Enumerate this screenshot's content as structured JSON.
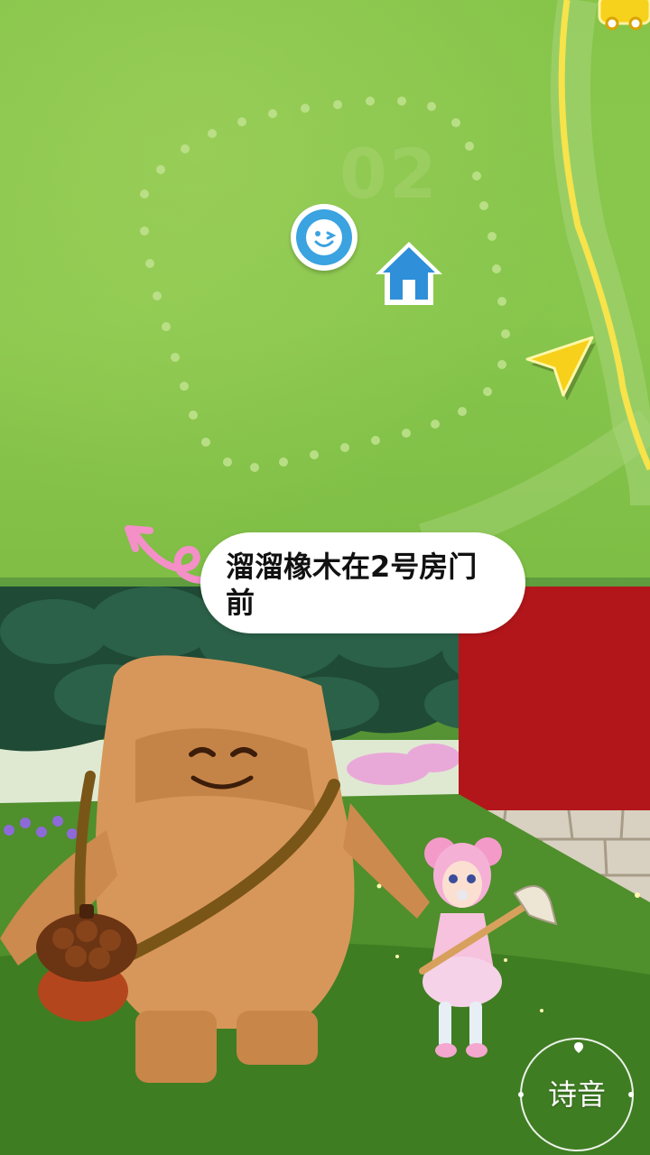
{
  "map": {
    "house_number": "02",
    "markers": {
      "avatar_icon": "smiling-face-icon",
      "house_icon": "house-icon",
      "nav_icon": "navigation-arrow-icon",
      "vehicle_icon": "bus-icon"
    }
  },
  "bubble": {
    "text": "溜溜橡木在2号房门前"
  },
  "actions": {
    "voice_button_label": "诗音"
  },
  "colors": {
    "map_green": "#8cc84e",
    "path_yellow": "#f7e34a",
    "marker_blue": "#3aa3e0",
    "bubble_white": "#ffffff",
    "pink_arrow": "#f48fc8",
    "house_red": "#b3161a"
  }
}
